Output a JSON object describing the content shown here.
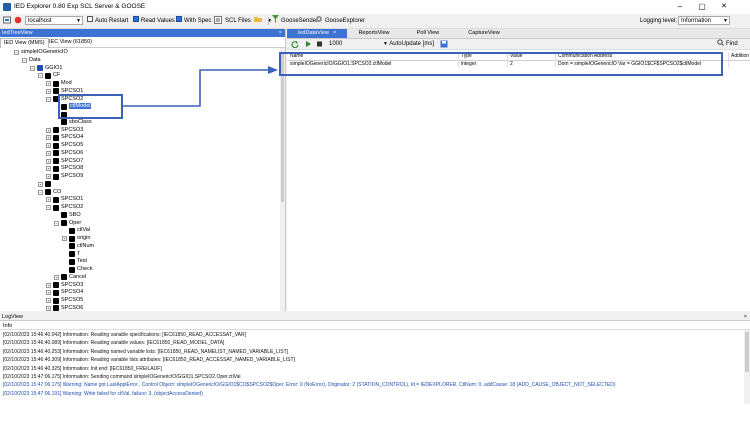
{
  "window": {
    "title": "IED Explorer 0.80 Exp SCL Server & GOOSE",
    "controls": [
      "–",
      "▢",
      "✕"
    ]
  },
  "toolbar": {
    "host": "localhost",
    "auto_restart": "Auto Restart",
    "read_values": "Read Values",
    "with_spec": "With Spec",
    "scl_files": "SCL Files",
    "goose_sender": "GooseSender",
    "goose_explorer": "GooseExplorer",
    "logging_level_label": "Logging level:",
    "logging_level_value": "Information"
  },
  "left_pane": {
    "title": "IedTreeView",
    "close": "×",
    "tabs": [
      "IED View (MMS)",
      "IEC View (61850)"
    ],
    "tree": [
      {
        "label": "simpleIOGenericIO",
        "depth": 1,
        "icon": "none",
        "exp": "−"
      },
      {
        "label": "Data",
        "depth": 2,
        "icon": "none",
        "exp": "−"
      },
      {
        "label": "GGIO1",
        "depth": 3,
        "icon": "blue",
        "exp": "−"
      },
      {
        "label": "CF",
        "depth": 4,
        "icon": "black",
        "exp": "−"
      },
      {
        "label": "Mod",
        "depth": 5,
        "icon": "black",
        "exp": "+"
      },
      {
        "label": "SPCSO1",
        "depth": 5,
        "icon": "black",
        "exp": "+"
      },
      {
        "label": "SPCSO2",
        "depth": 5,
        "icon": "black",
        "exp": "−"
      },
      {
        "label": "ctlModel",
        "depth": 6,
        "icon": "black",
        "exp": "",
        "selected": true
      },
      {
        "label": "",
        "depth": 6,
        "icon": "black",
        "exp": ""
      },
      {
        "label": "sboClass",
        "depth": 6,
        "icon": "black",
        "exp": ""
      },
      {
        "label": "SPCSO3",
        "depth": 5,
        "icon": "black",
        "exp": "+"
      },
      {
        "label": "SPCSO4",
        "depth": 5,
        "icon": "black",
        "exp": "+"
      },
      {
        "label": "SPCSO5",
        "depth": 5,
        "icon": "black",
        "exp": "+"
      },
      {
        "label": "SPCSO6",
        "depth": 5,
        "icon": "black",
        "exp": "+"
      },
      {
        "label": "SPCSO7",
        "depth": 5,
        "icon": "black",
        "exp": "+"
      },
      {
        "label": "SPCSO8",
        "depth": 5,
        "icon": "black",
        "exp": "+"
      },
      {
        "label": "SPCSO9",
        "depth": 5,
        "icon": "black",
        "exp": "+"
      },
      {
        "label": "",
        "depth": 4,
        "icon": "black",
        "exp": "+"
      },
      {
        "label": "CO",
        "depth": 4,
        "icon": "black",
        "exp": "−"
      },
      {
        "label": "SPCSO1",
        "depth": 5,
        "icon": "black",
        "exp": "+"
      },
      {
        "label": "SPCSO2",
        "depth": 5,
        "icon": "black",
        "exp": "−"
      },
      {
        "label": "SBO",
        "depth": 6,
        "icon": "black",
        "exp": ""
      },
      {
        "label": "Oper",
        "depth": 6,
        "icon": "black",
        "exp": "−"
      },
      {
        "label": "ctlVal",
        "depth": 7,
        "icon": "black",
        "exp": ""
      },
      {
        "label": "origin",
        "depth": 7,
        "icon": "black",
        "exp": "+"
      },
      {
        "label": "ctlNum",
        "depth": 7,
        "icon": "black",
        "exp": ""
      },
      {
        "label": "T",
        "depth": 7,
        "icon": "black",
        "exp": ""
      },
      {
        "label": "Test",
        "depth": 7,
        "icon": "black",
        "exp": ""
      },
      {
        "label": "Check",
        "depth": 7,
        "icon": "black",
        "exp": ""
      },
      {
        "label": "Cancel",
        "depth": 6,
        "icon": "black",
        "exp": "+"
      },
      {
        "label": "SPCSO3",
        "depth": 5,
        "icon": "black",
        "exp": "+"
      },
      {
        "label": "SPCSO4",
        "depth": 5,
        "icon": "black",
        "exp": "+"
      },
      {
        "label": "SPCSO5",
        "depth": 5,
        "icon": "black",
        "exp": "+"
      },
      {
        "label": "SPCSO6",
        "depth": 5,
        "icon": "black",
        "exp": "+"
      }
    ]
  },
  "right_pane": {
    "tabs": [
      "IedDataView",
      "ReportsView",
      "Poll View",
      "CaptureView"
    ],
    "tab_close": "×",
    "interval": "1000",
    "auto_update": "AutoUpdate [ms]",
    "find": "Find",
    "columns": [
      "Name",
      "Type",
      "Value",
      "Communication Address",
      "Addition"
    ],
    "rows": [
      {
        "name": "simpleIOGenericIO/GGIO1.SPCSO2.ctlModel",
        "type": "integer",
        "value": "2",
        "address": "Dom = simpleIOGenericIO Var = GGIO1$CF$SPCSO2$ctlModel"
      }
    ]
  },
  "log": {
    "title": "LogView",
    "close": "×",
    "filter": "Info",
    "lines": [
      {
        "text": "[02/10/2023 15:46:40.042] Information: Reading variable specifications: [IEC61850_READ_ACCESSAT_VAR]",
        "level": "info"
      },
      {
        "text": "[02/10/2023 15:46:40.089] Information: Reading variable values: [IEC61850_READ_MODEL_DATA]",
        "level": "info"
      },
      {
        "text": "[02/10/2023 15:46:40.253] Information: Reading named variable lists: [IEC61850_READ_NAMELIST_NAMED_VARIABLE_LIST]",
        "level": "info"
      },
      {
        "text": "[02/10/2023 15:46:40.309] Information: Reading variable lists attributes: [IEC61850_READ_ACCESSAT_NAMED_VARIABLE_LIST]",
        "level": "info"
      },
      {
        "text": "[02/10/2023 15:46:40.325] Information: Init end: [IEC61850_FREILAUF]",
        "level": "info"
      },
      {
        "text": "[02/10/2023 15:47:06.175] Information: Sending command simpleIOGenericIO/GGIO1.SPCSO2.Oper.ctlVal",
        "level": "info"
      },
      {
        "text": "[02/10/2023 15:47:06.175] Warning: Name got LastApplError , Control Object: simpleIOGenericIO/GGIO1$CO$SPCSO2$Oper, Error: 0 (NoError), Originator: 2 (STATION_CONTROL), Id = IEDEXPLORER, CtlNum: 0, addCause: 18 (ADD_CAUSE_OBJECT_NOT_SELECTED)",
        "level": "warn"
      },
      {
        "text": "[02/10/2023 15:47:06.191] Warning: Write failed for ctlVal, failure: 3, (objectAccessDenied)",
        "level": "warn"
      }
    ]
  },
  "colors": {
    "accent": "#3c72d1",
    "annotation": "#3b62b8",
    "warning_text": "#1f4fb0"
  }
}
